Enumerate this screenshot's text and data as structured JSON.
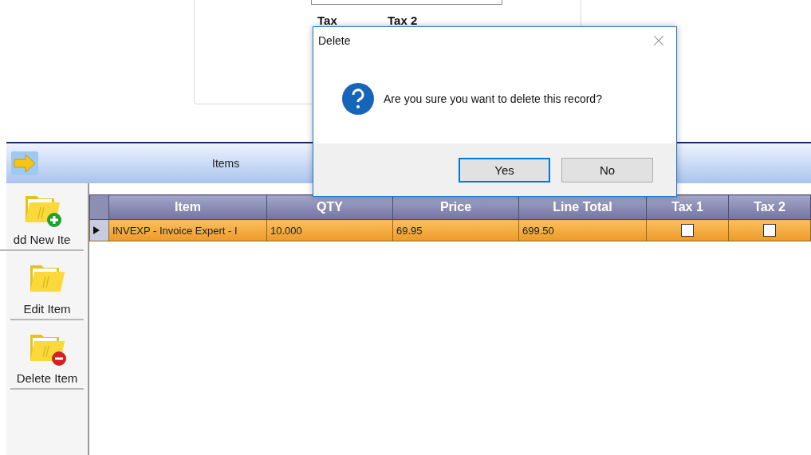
{
  "background_form": {
    "labels": [
      "Tax",
      "Tax 2"
    ]
  },
  "items_panel": {
    "title": "Items"
  },
  "sidebar": {
    "buttons": [
      {
        "label": "dd New Ite",
        "kind": "add"
      },
      {
        "label": "Edit Item",
        "kind": "edit"
      },
      {
        "label": "Delete Item",
        "kind": "delete"
      }
    ]
  },
  "grid": {
    "columns": [
      "Item",
      "QTY",
      "Price",
      "Line Total",
      "Tax 1",
      "Tax 2"
    ],
    "rows": [
      {
        "selected": true,
        "current": true,
        "item": "INVEXP - Invoice Expert - I",
        "qty": "10.000",
        "price": "69.95",
        "line_total": "699.50",
        "tax_1": false,
        "tax_2": false
      }
    ]
  },
  "dialog": {
    "title": "Delete",
    "message": "Are you sure you want to delete this record?",
    "buttons": [
      {
        "label": "Yes",
        "default": true
      },
      {
        "label": "No",
        "default": false
      }
    ]
  }
}
